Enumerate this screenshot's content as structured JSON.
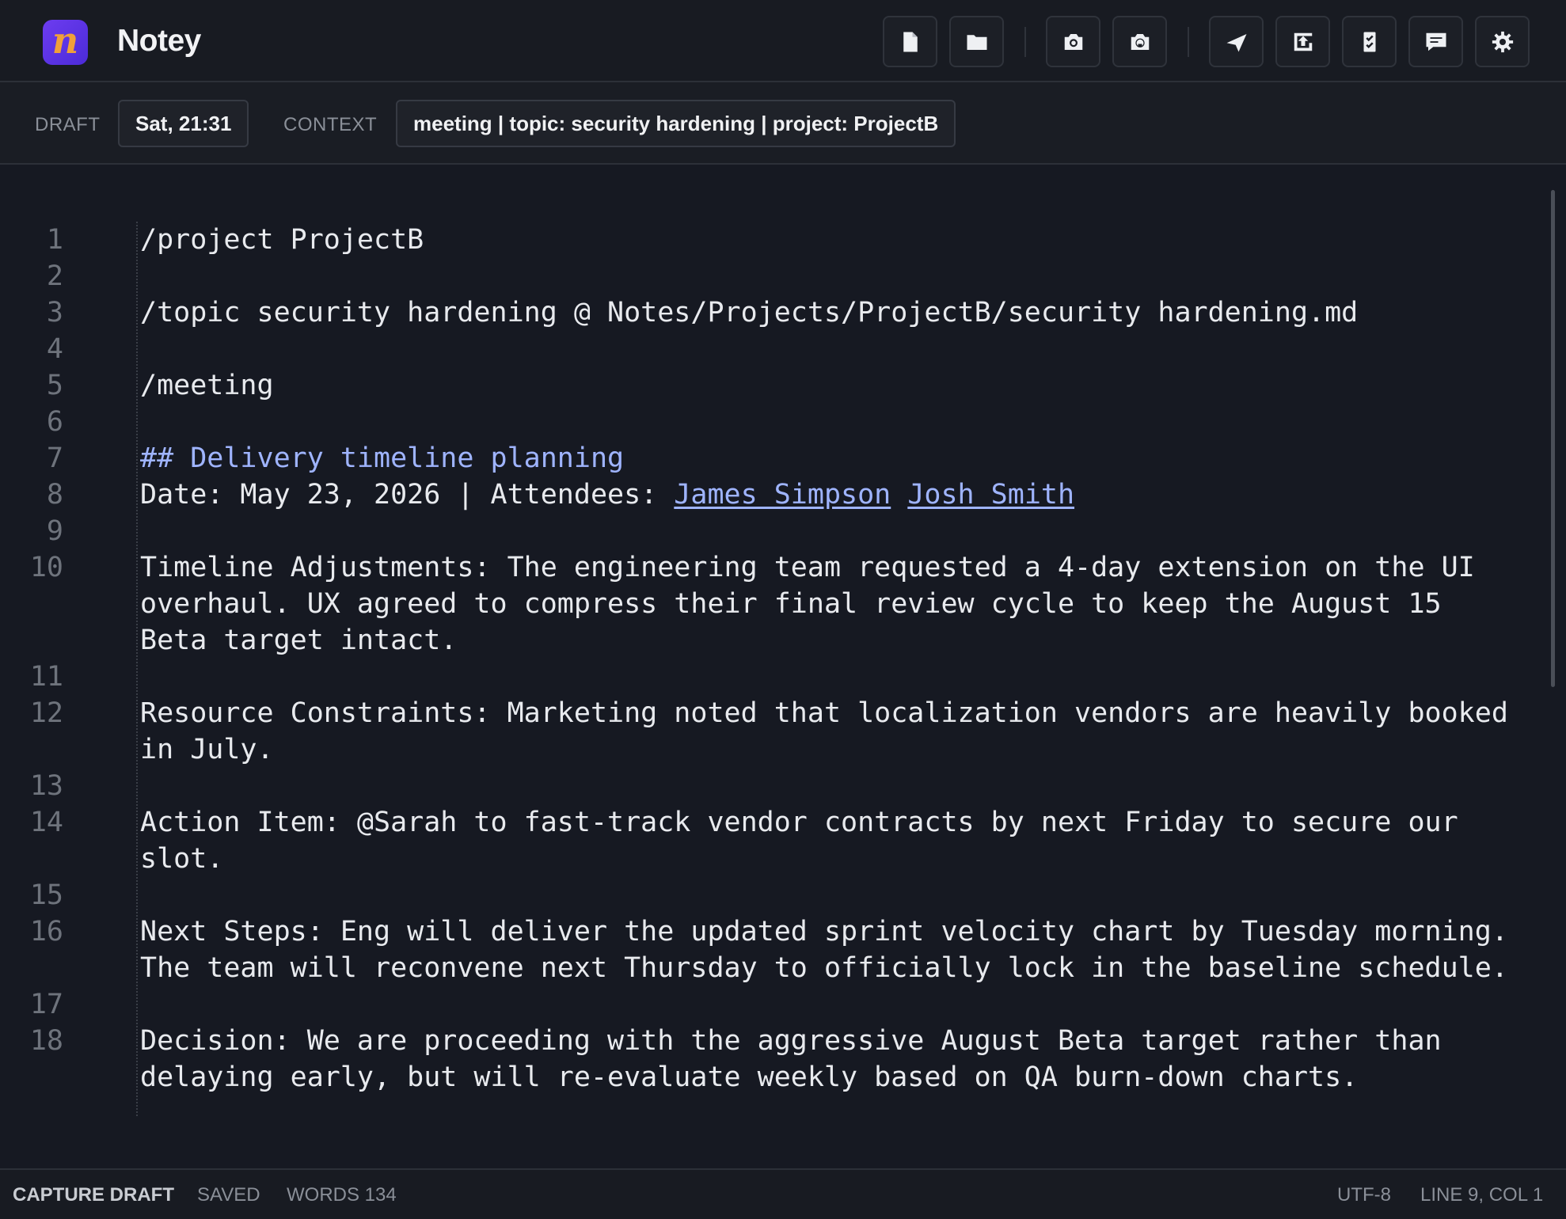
{
  "app": {
    "logo_letter": "n",
    "title": "Notey",
    "accent": "#5b34e6"
  },
  "toolbar": {
    "buttons": [
      {
        "name": "new-file",
        "icon": "file-icon"
      },
      {
        "name": "open-folder",
        "icon": "folder-icon"
      },
      {
        "name": "screenshot",
        "icon": "camera-icon"
      },
      {
        "name": "screenshot-alt",
        "icon": "camera-lens-icon"
      },
      {
        "name": "send",
        "icon": "send-icon"
      },
      {
        "name": "upload",
        "icon": "upload-icon"
      },
      {
        "name": "tasks",
        "icon": "checklist-icon"
      },
      {
        "name": "comments",
        "icon": "comment-icon"
      },
      {
        "name": "settings",
        "icon": "gear-icon"
      }
    ]
  },
  "context_bar": {
    "draft_label": "DRAFT",
    "draft_value": "Sat, 21:31",
    "context_label": "CONTEXT",
    "context_value": "meeting | topic: security hardening | project: ProjectB"
  },
  "editor": {
    "lines": [
      {
        "n": "1",
        "text": "/project ProjectB"
      },
      {
        "n": "2",
        "text": ""
      },
      {
        "n": "3",
        "text": "/topic security hardening @ Notes/Projects/ProjectB/security hardening.md"
      },
      {
        "n": "4",
        "text": ""
      },
      {
        "n": "5",
        "text": "/meeting"
      },
      {
        "n": "6",
        "text": ""
      },
      {
        "n": "7",
        "text": "## Delivery timeline planning"
      },
      {
        "n": "8",
        "prefix": "Date: May 23, 2026 | Attendees: ",
        "attendees": [
          "James Simpson",
          "Josh Smith"
        ]
      },
      {
        "n": "9",
        "text": ""
      },
      {
        "n": "10",
        "wrapped": [
          "Timeline Adjustments: The engineering team requested a 4-day extension on the UI",
          "overhaul. UX agreed to compress their final review cycle to keep the August 15",
          "Beta target intact."
        ]
      },
      {
        "n": "11",
        "text": ""
      },
      {
        "n": "12",
        "wrapped": [
          "Resource Constraints: Marketing noted that localization vendors are heavily booked",
          "in July."
        ]
      },
      {
        "n": "13",
        "text": ""
      },
      {
        "n": "14",
        "wrapped": [
          "Action Item: @Sarah to fast-track vendor contracts by next Friday to secure our",
          "slot."
        ]
      },
      {
        "n": "15",
        "text": ""
      },
      {
        "n": "16",
        "wrapped": [
          "Next Steps: Eng will deliver the updated sprint velocity chart by Tuesday morning.",
          "The team will reconvene next Thursday to officially lock in the baseline schedule."
        ]
      },
      {
        "n": "17",
        "text": ""
      },
      {
        "n": "18",
        "wrapped": [
          "Decision: We are proceeding with the aggressive August Beta target rather than",
          "delaying early, but will re-evaluate weekly based on QA burn-down charts."
        ]
      }
    ]
  },
  "status_bar": {
    "mode": "CAPTURE DRAFT",
    "saved": "SAVED",
    "words": "WORDS 134",
    "encoding": "UTF-8",
    "position": "LINE 9, COL 1"
  }
}
